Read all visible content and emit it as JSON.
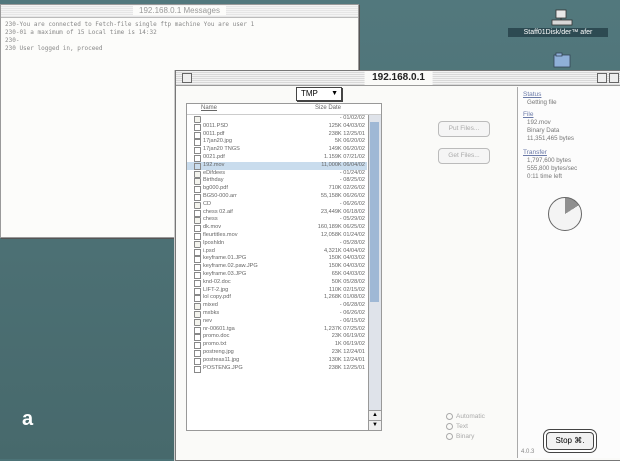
{
  "figure_label": "a",
  "messages_window": {
    "title": "192.168.0.1 Messages",
    "lines": [
      "230-You are connected to Fetch-file single ftp machine   You are user 1",
      "230-01 a maximum of 15   Local time is 14:32",
      "230-",
      "230 User logged in, proceed"
    ]
  },
  "desktop_icon_label": "Staff01Disk/der™ afer",
  "ftp_window": {
    "title": "192.168.0.1",
    "directory": "TMP",
    "col_name": "Name",
    "col_size_date": "Size Date",
    "files": [
      {
        "name": "",
        "size": "- 01/02/02",
        "type": "folder"
      },
      {
        "name": "0011.PSD",
        "size": "125K 04/03/02",
        "type": "file"
      },
      {
        "name": "0011.pdf",
        "size": "238K 12/25/01",
        "type": "file"
      },
      {
        "name": "17jan20.jpg",
        "size": "5K 06/20/02",
        "type": "file"
      },
      {
        "name": "17jan20 TNGS",
        "size": "149K 06/20/02",
        "type": "file"
      },
      {
        "name": "0021.pdf",
        "size": "1.159K 07/21/02",
        "type": "file"
      },
      {
        "name": "192.mov",
        "size": "11,000K 06/04/02",
        "type": "file"
      },
      {
        "name": "eDifdees",
        "size": "- 01/24/02",
        "type": "folder"
      },
      {
        "name": "Birthday",
        "size": "- 08/25/02",
        "type": "folder"
      },
      {
        "name": "bg000.pdf",
        "size": "710K 02/26/02",
        "type": "file"
      },
      {
        "name": "BG50-000.arr",
        "size": "55,158K 06/26/02",
        "type": "file"
      },
      {
        "name": "CD",
        "size": "- 06/26/02",
        "type": "folder"
      },
      {
        "name": "chess 02.aif",
        "size": "23,449K 06/18/02",
        "type": "file"
      },
      {
        "name": "chess",
        "size": "- 05/29/02",
        "type": "folder"
      },
      {
        "name": "dk.mov",
        "size": "160,189K 06/25/02",
        "type": "file"
      },
      {
        "name": "fleurtitles.mov",
        "size": "12,058K 01/24/02",
        "type": "file"
      },
      {
        "name": "Iposhldn",
        "size": "- 05/28/02",
        "type": "folder"
      },
      {
        "name": "i.psd",
        "size": "4,321K 04/04/02",
        "type": "file"
      },
      {
        "name": "keyframe.01.JPG",
        "size": "150K 04/03/02",
        "type": "file"
      },
      {
        "name": "keyframe.02.paw.JPG",
        "size": "150K 04/03/02",
        "type": "file"
      },
      {
        "name": "keyframe.03.JPG",
        "size": "65K 04/03/02",
        "type": "file"
      },
      {
        "name": "knd-02.doc",
        "size": "50K 05/28/02",
        "type": "file"
      },
      {
        "name": "LIFT-2.jpg",
        "size": "110K 02/15/02",
        "type": "file"
      },
      {
        "name": "lol copy.pdf",
        "size": "1,268K 01/08/02",
        "type": "file"
      },
      {
        "name": "mixed",
        "size": "- 06/28/02",
        "type": "folder"
      },
      {
        "name": "mxbks",
        "size": "- 06/26/02",
        "type": "folder"
      },
      {
        "name": "nev",
        "size": "- 06/15/02",
        "type": "folder"
      },
      {
        "name": "nr-00601.tga",
        "size": "1,237K 07/25/02",
        "type": "file"
      },
      {
        "name": "promo.doc",
        "size": "23K 06/19/02",
        "type": "file"
      },
      {
        "name": "promo.txt",
        "size": "1K 06/19/02",
        "type": "file"
      },
      {
        "name": "postreng.jpg",
        "size": "23K 12/24/01",
        "type": "file"
      },
      {
        "name": "postreas11.jpg",
        "size": "130K 12/24/01",
        "type": "file"
      },
      {
        "name": "POSTENG.JPG",
        "size": "238K 12/25/01",
        "type": "file"
      }
    ],
    "put_files_label": "Put Files...",
    "get_files_label": "Get Files...",
    "radio_automatic": "Automatic",
    "radio_text": "Text",
    "radio_binary": "Binary",
    "status": {
      "status_heading": "Status",
      "status_value": "Getting file",
      "file_heading": "File",
      "file_lines": [
        "192.mov",
        "Binary Data",
        "11,351,465 bytes"
      ],
      "transfer_heading": "Transfer",
      "transfer_lines": [
        "1,797,600 bytes",
        "555,800 bytes/sec",
        "0:11 time left"
      ],
      "transfer_fraction": 0.16
    },
    "stop_label": "Stop",
    "stop_key": "⌘.",
    "version": "4.0.3"
  }
}
